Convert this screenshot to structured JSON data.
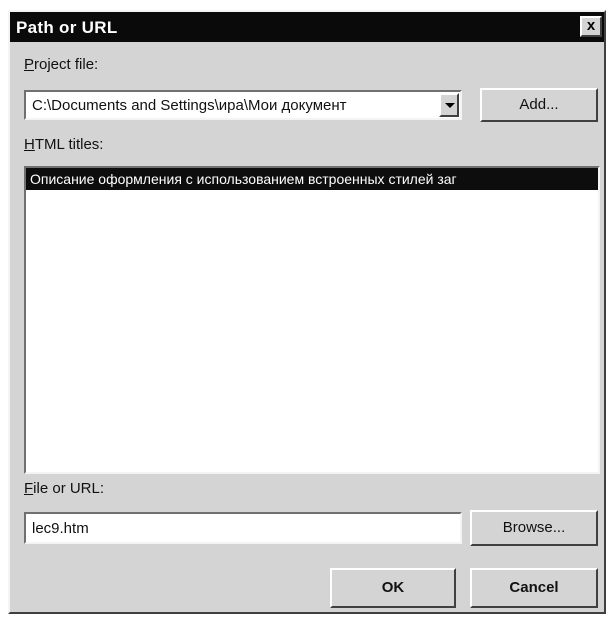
{
  "window": {
    "title": "Path or URL",
    "close_label": "x"
  },
  "project": {
    "label_accel": "P",
    "label_rest": "roject file:",
    "value": "C:\\Documents and Settings\\ира\\Мои документ",
    "add_label": "Add..."
  },
  "html_titles": {
    "label_accel": "H",
    "label_rest": "TML titles:",
    "items": [
      "Описание оформления с использованием встроенных стилей заг"
    ]
  },
  "file": {
    "label_accel": "F",
    "label_rest": "ile or URL:",
    "value": "lec9.htm",
    "browse_label": "Browse..."
  },
  "footer": {
    "ok_label": "OK",
    "cancel_label": "Cancel"
  }
}
